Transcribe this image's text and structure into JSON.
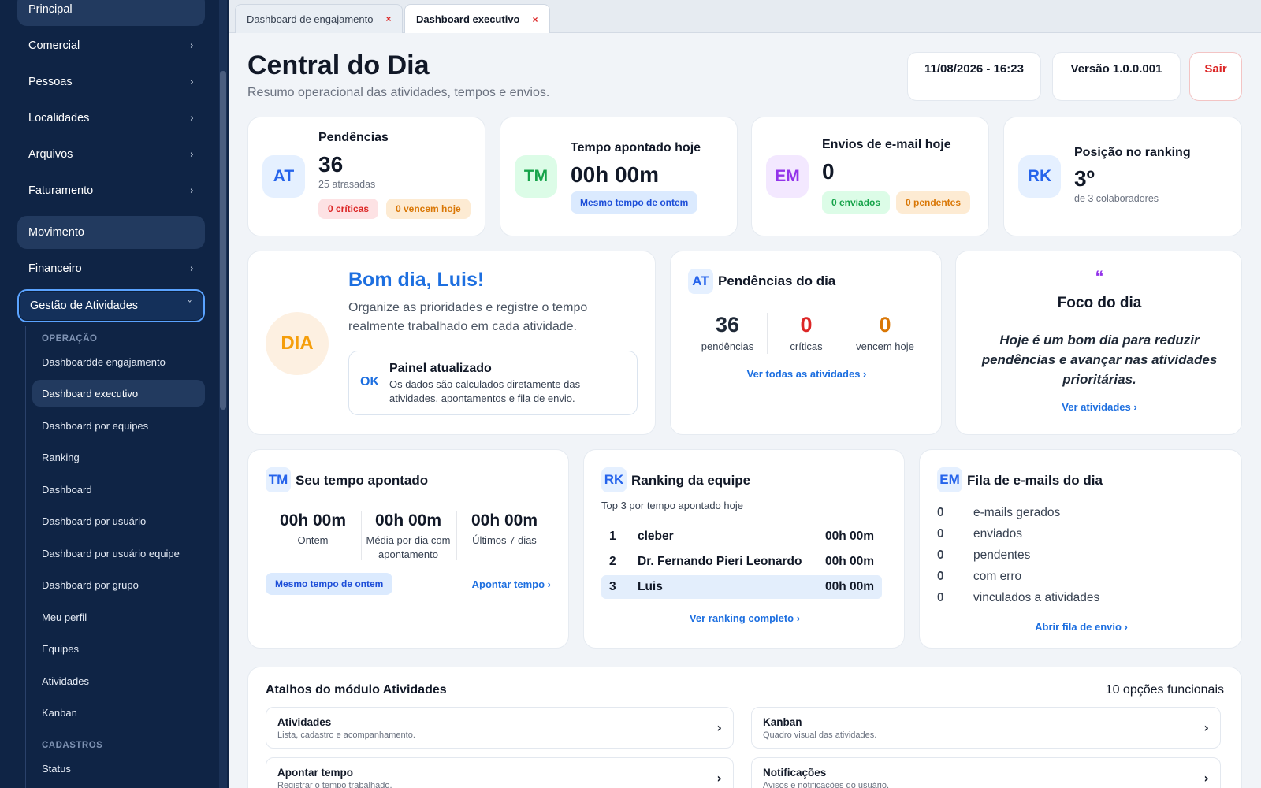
{
  "sidebar": {
    "items": [
      {
        "label": "Principal"
      },
      {
        "label": "Comercial",
        "chevron": "›"
      },
      {
        "label": "Pessoas",
        "chevron": "›"
      },
      {
        "label": "Localidades",
        "chevron": "›"
      },
      {
        "label": "Arquivos",
        "chevron": "›"
      },
      {
        "label": "Faturamento",
        "chevron": "›"
      },
      {
        "label": "Movimento"
      },
      {
        "label": "Financeiro",
        "chevron": "›"
      },
      {
        "label": "Gestão de Atividades",
        "chevron": "ˇ"
      }
    ],
    "sections": {
      "operacao": "OPERAÇÃO",
      "cadastros": "CADASTROS"
    },
    "sub_items": [
      "Dashboardde engajamento",
      "Dashboard executivo",
      "Dashboard por equipes",
      "Ranking",
      "Dashboard",
      "Dashboard por usuário",
      "Dashboard por usuário equipe",
      "Dashboard por grupo",
      "Meu perfil",
      "Equipes",
      "Atividades",
      "Kanban",
      "Status"
    ]
  },
  "tabs": [
    {
      "label": "Dashboard de engajamento",
      "close": "×"
    },
    {
      "label": "Dashboard executivo",
      "close": "×"
    }
  ],
  "header": {
    "title": "Central do Dia",
    "subtitle": "Resumo operacional das atividades, tempos e envios.",
    "datetime": "11/08/2026 - 16:23",
    "version": "Versão 1.0.0.001",
    "logout": "Sair"
  },
  "kpis": {
    "pendencias": {
      "avatar": "AT",
      "label": "Pendências",
      "value": "36",
      "note": "25 atrasadas",
      "badge1": "0 críticas",
      "badge2": "0 vencem hoje"
    },
    "tempo": {
      "avatar": "TM",
      "label": "Tempo apontado hoje",
      "value": "00h 00m",
      "badge": "Mesmo tempo de ontem"
    },
    "envios": {
      "avatar": "EM",
      "label": "Envios de e-mail hoje",
      "value": "0",
      "badge1": "0 enviados",
      "badge2": "0 pendentes"
    },
    "ranking": {
      "avatar": "RK",
      "label": "Posição no ranking",
      "value": "3º",
      "note": "de 3 colaboradores"
    }
  },
  "welcome": {
    "avatar": "DIA",
    "title": "Bom dia, Luis!",
    "text": "Organize as prioridades e registre o tempo realmente trabalhado em cada atividade.",
    "status_icon": "OK",
    "status_title": "Painel atualizado",
    "status_text": "Os dados são calculados diretamente das atividades, apontamentos e fila de envio."
  },
  "pendencias_dia": {
    "avatar": "AT",
    "title": "Pendências do dia",
    "stats": [
      {
        "value": "36",
        "label": "pendências",
        "color": "#111827"
      },
      {
        "value": "0",
        "label": "críticas",
        "color": "#dc2626"
      },
      {
        "value": "0",
        "label": "vencem hoje",
        "color": "#d97706"
      }
    ],
    "link": "Ver todas as atividades ›"
  },
  "foco": {
    "quote_icon": "“",
    "title": "Foco do dia",
    "text": "Hoje é um bom dia para reduzir pendências e avançar nas atividades prioritárias.",
    "link": "Ver atividades ›"
  },
  "tempo_apontado": {
    "avatar": "TM",
    "title": "Seu tempo apontado",
    "stats": [
      {
        "value": "00h 00m",
        "label": "Ontem"
      },
      {
        "value": "00h 00m",
        "label": "Média por dia com apontamento"
      },
      {
        "value": "00h 00m",
        "label": "Últimos 7 dias"
      }
    ],
    "badge": "Mesmo tempo de ontem",
    "link": "Apontar tempo ›"
  },
  "ranking_equipe": {
    "avatar": "RK",
    "title": "Ranking da equipe",
    "subtitle": "Top 3 por tempo apontado hoje",
    "rows": [
      {
        "pos": "1",
        "name": "cleber",
        "time": "00h 00m"
      },
      {
        "pos": "2",
        "name": "Dr. Fernando Pieri Leonardo",
        "time": "00h 00m"
      },
      {
        "pos": "3",
        "name": "Luis",
        "time": "00h 00m"
      }
    ],
    "link": "Ver ranking completo ›"
  },
  "fila_emails": {
    "avatar": "EM",
    "title": "Fila de e-mails do dia",
    "rows": [
      {
        "n": "0",
        "label": "e-mails gerados"
      },
      {
        "n": "0",
        "label": "enviados"
      },
      {
        "n": "0",
        "label": "pendentes"
      },
      {
        "n": "0",
        "label": "com erro"
      },
      {
        "n": "0",
        "label": "vinculados a atividades"
      }
    ],
    "link": "Abrir fila de envio ›"
  },
  "atalhos": {
    "title": "Atalhos do módulo Atividades",
    "count": "10 opções funcionais",
    "items": [
      {
        "title": "Atividades",
        "desc": "Lista, cadastro e acompanhamento.",
        "arrow": "›"
      },
      {
        "title": "Kanban",
        "desc": "Quadro visual das atividades.",
        "arrow": "›"
      },
      {
        "title": "Apontar tempo",
        "desc": "Registrar o tempo trabalhado.",
        "arrow": "›"
      },
      {
        "title": "Notificações",
        "desc": "Avisos e notificações do usuário.",
        "arrow": "›"
      }
    ]
  }
}
